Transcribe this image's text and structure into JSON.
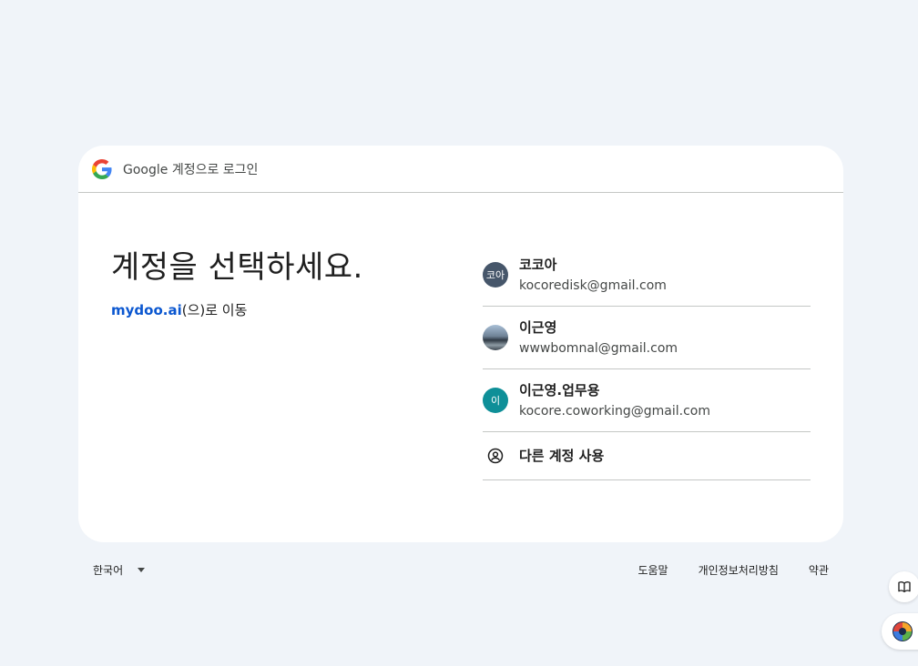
{
  "header": {
    "title": "Google 계정으로 로그인"
  },
  "main": {
    "heading": "계정을 선택하세요.",
    "continue_link": "mydoo.ai",
    "continue_suffix": "(으)로 이동"
  },
  "accounts": [
    {
      "avatar_text": "코아",
      "name": "코코아",
      "email": "kocoredisk@gmail.com",
      "avatar_color": "#46566a"
    },
    {
      "avatar_text": "",
      "name": "이근영",
      "email": "wwwbomnal@gmail.com",
      "avatar_color": "photo"
    },
    {
      "avatar_text": "이",
      "name": "이근영.업무용",
      "email": "kocore.coworking@gmail.com",
      "avatar_color": "#0e8f98"
    }
  ],
  "other_account": {
    "label": "다른 계정 사용",
    "icon": "account-circle-icon"
  },
  "footer": {
    "language": "한국어",
    "help": "도움말",
    "privacy": "개인정보처리방침",
    "terms": "약관"
  },
  "colors": {
    "page_bg": "#f0f4f9",
    "link": "#0b57d0",
    "divider": "#c4c7c5"
  },
  "side_icons": [
    "book-icon",
    "extension-icon"
  ]
}
